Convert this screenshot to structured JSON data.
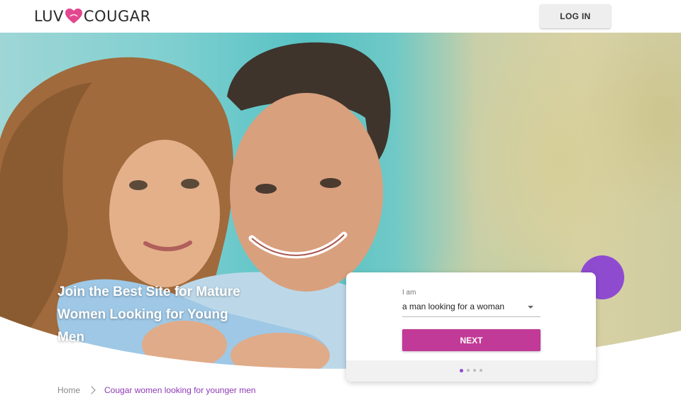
{
  "header": {
    "logo_left": "LUV",
    "logo_right": "COUGAR",
    "login_label": "LOG IN"
  },
  "hero": {
    "headline": "Join the Best Site for Mature Women Looking for Young Men"
  },
  "signup_form": {
    "field_label": "I am",
    "selected_option": "a man looking for a woman",
    "next_label": "NEXT",
    "steps_total": 4,
    "current_step": 1
  },
  "breadcrumb": {
    "home": "Home",
    "current": "Cougar women looking for younger men"
  },
  "colors": {
    "accent_button": "#c13a97",
    "accent_purple": "#8e4bd0",
    "logo_heart": "#e2478f"
  }
}
